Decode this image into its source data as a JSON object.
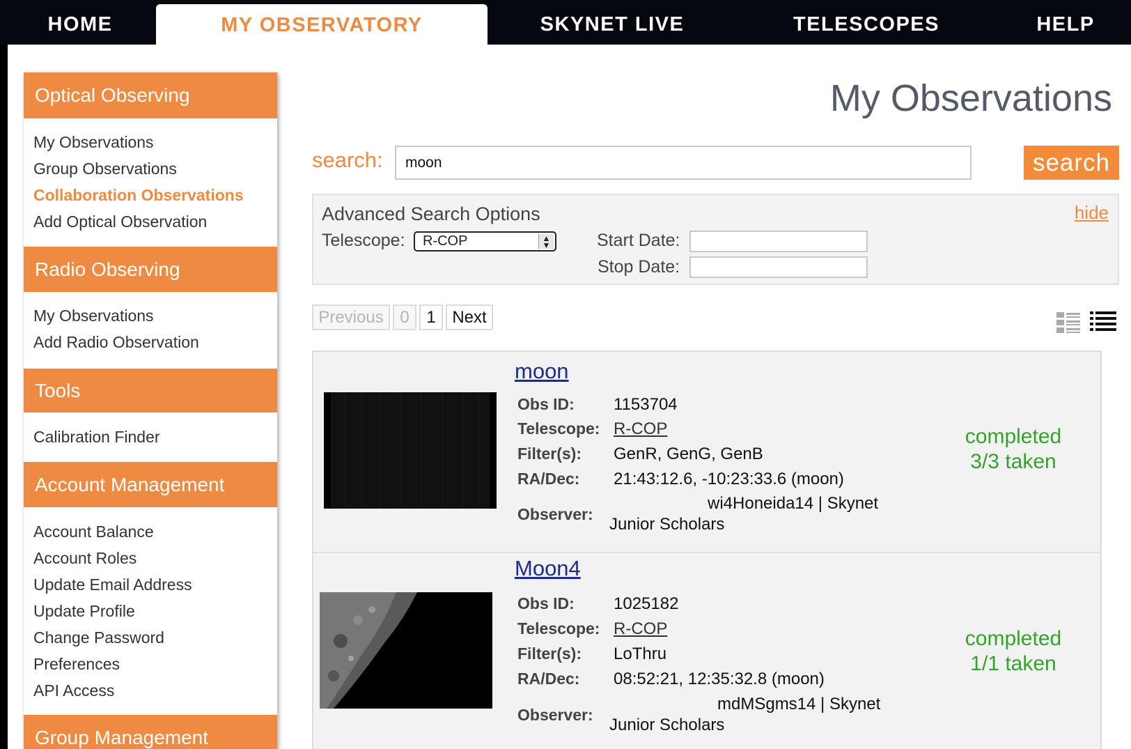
{
  "nav": {
    "tabs": [
      {
        "label": "HOME"
      },
      {
        "label": "MY OBSERVATORY"
      },
      {
        "label": "SKYNET LIVE"
      },
      {
        "label": "TELESCOPES"
      },
      {
        "label": "HELP"
      }
    ],
    "active_tab": "MY OBSERVATORY"
  },
  "sidebar": {
    "sections": [
      {
        "title": "Optical Observing",
        "items": [
          "My Observations",
          "Group Observations",
          "Collaboration Observations",
          "Add Optical Observation"
        ]
      },
      {
        "title": "Radio Observing",
        "items": [
          "My Observations",
          "Add Radio Observation"
        ]
      },
      {
        "title": "Tools",
        "items": [
          "Calibration Finder"
        ]
      },
      {
        "title": "Account Management",
        "items": [
          "Account Balance",
          "Account Roles",
          "Update Email Address",
          "Update Profile",
          "Change Password",
          "Preferences",
          "API Access"
        ]
      },
      {
        "title": "Group Management",
        "items": []
      }
    ],
    "active_item": "Collaboration Observations"
  },
  "main": {
    "title": "My Observations",
    "search": {
      "label": "search:",
      "value": "moon",
      "button_label": "search"
    },
    "advanced": {
      "title": "Advanced Search Options",
      "hide_label": "hide",
      "telescope_label": "Telescope:",
      "telescope_value": "R-COP",
      "start_date_label": "Start Date:",
      "stop_date_label": "Stop Date:",
      "start_date_value": "",
      "stop_date_value": ""
    },
    "pager": {
      "previous": "Previous",
      "pages": [
        "0",
        "1"
      ],
      "next": "Next"
    },
    "field_labels": {
      "obs_id": "Obs ID:",
      "telescope": "Telescope:",
      "filters": "Filter(s):",
      "radec": "RA/Dec:",
      "observer": "Observer:"
    },
    "results": [
      {
        "name": "moon",
        "obs_id": "1153704",
        "telescope": "R-COP",
        "filters": "GenR, GenG, GenB",
        "radec": "21:43:12.6, -10:23:33.6 (moon)",
        "observer_line1": "wi4Honeida14 | Skynet",
        "observer_line2": "Junior Scholars",
        "status": "completed",
        "taken": "3/3 taken"
      },
      {
        "name": "Moon4",
        "obs_id": "1025182",
        "telescope": "R-COP",
        "filters": "LoThru",
        "radec": "08:52:21, 12:35:32.8 (moon)",
        "observer_line1": "mdMSgms14 | Skynet",
        "observer_line2": "Junior Scholars",
        "status": "completed",
        "taken": "1/1 taken"
      }
    ]
  },
  "colors": {
    "accent": "#ee8a41",
    "status_green": "#33a32a",
    "link_blue": "#1d2a8f"
  }
}
